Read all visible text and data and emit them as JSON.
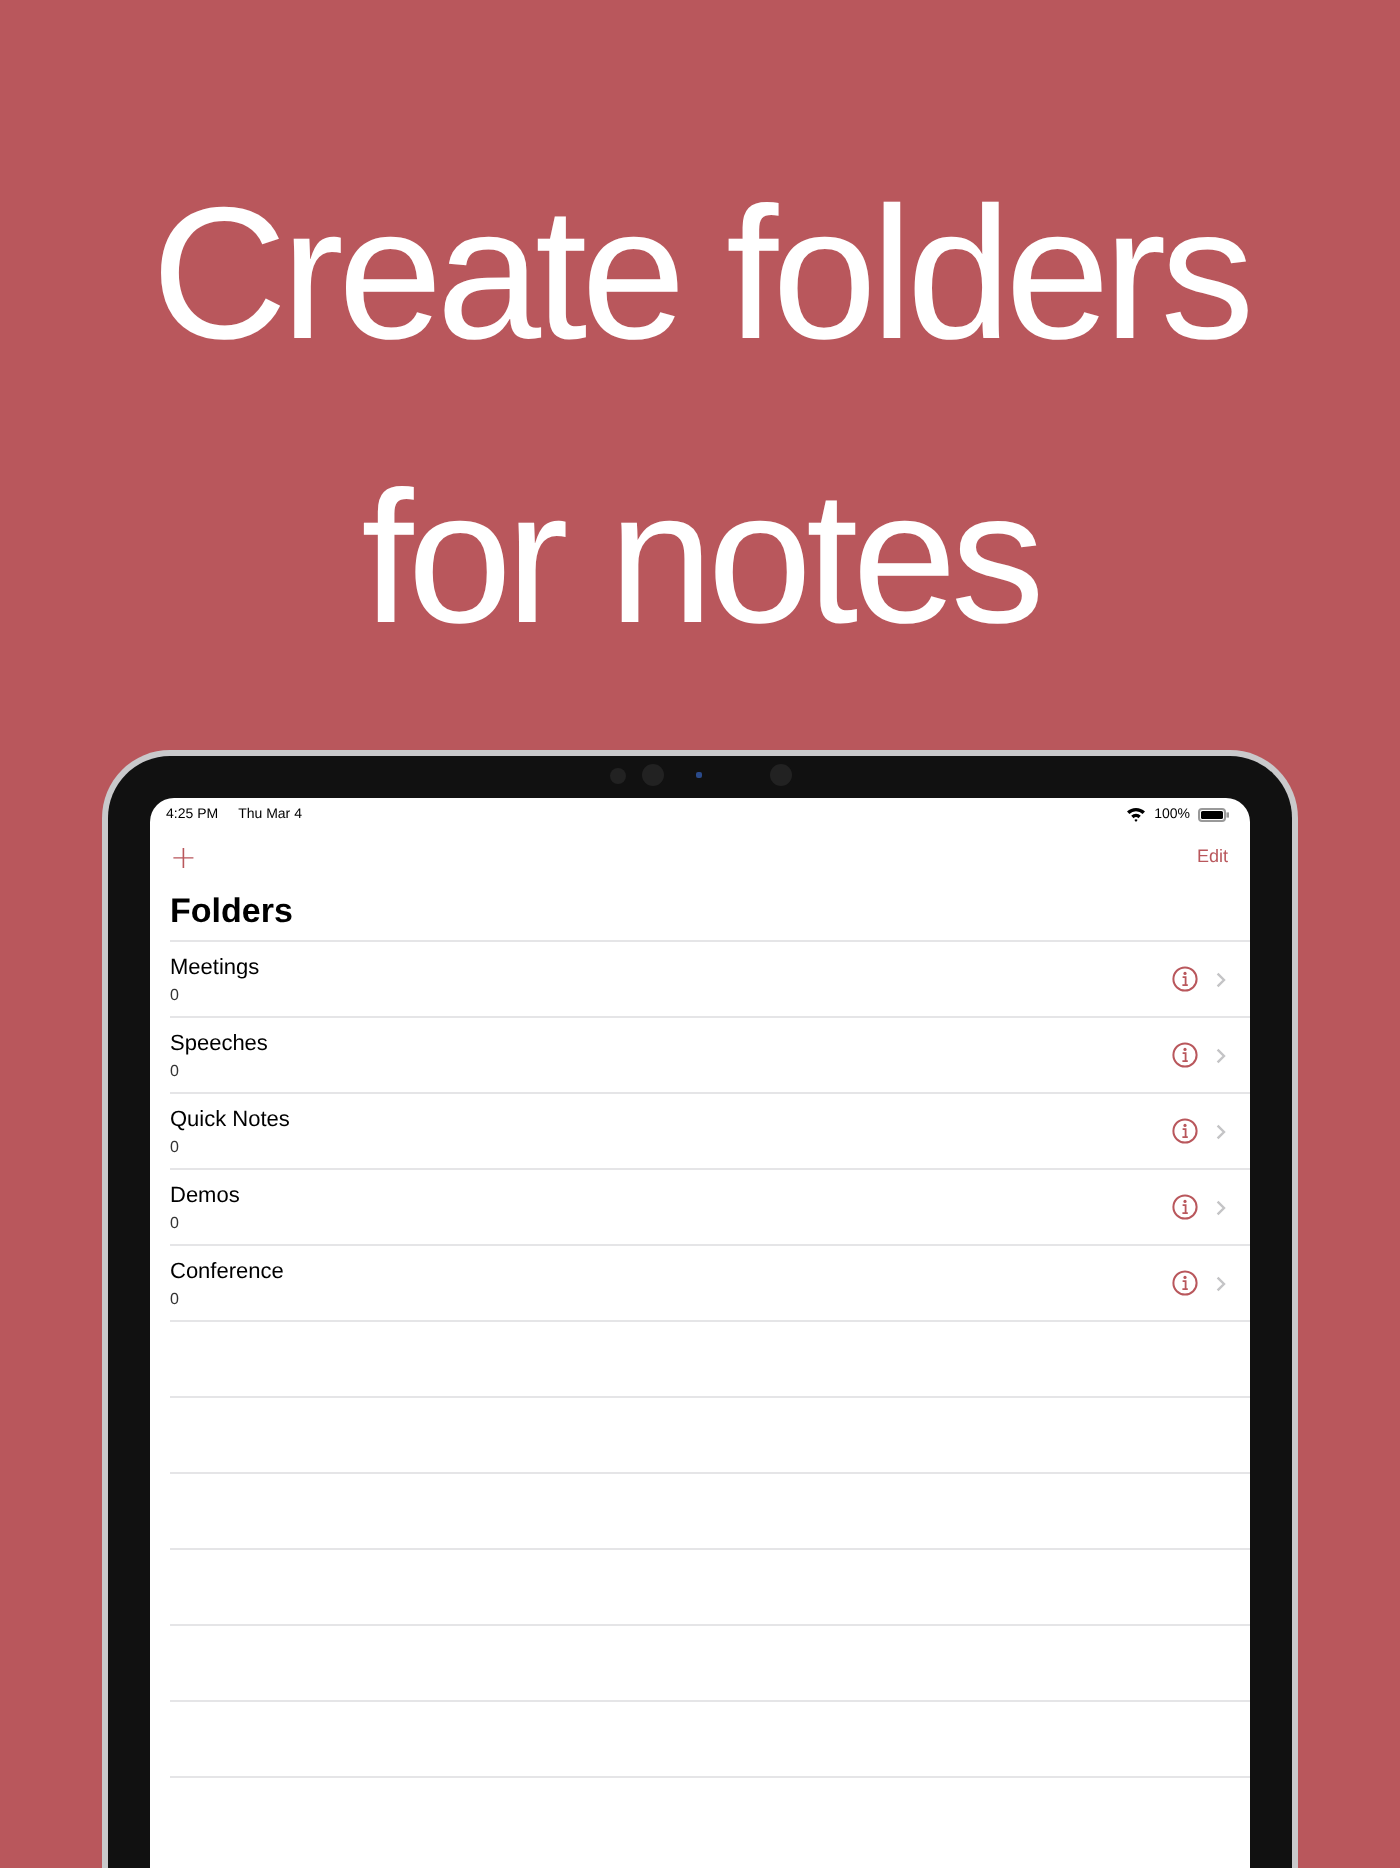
{
  "headline": [
    "Create folders",
    "for notes"
  ],
  "status_bar": {
    "time": "4:25 PM",
    "date": "Thu Mar 4",
    "battery": "100%"
  },
  "nav": {
    "add": "+",
    "edit": "Edit",
    "title": "Folders"
  },
  "folders": [
    {
      "name": "Meetings",
      "count": "0"
    },
    {
      "name": "Speeches",
      "count": "0"
    },
    {
      "name": "Quick Notes",
      "count": "0"
    },
    {
      "name": "Demos",
      "count": "0"
    },
    {
      "name": "Conference",
      "count": "0"
    }
  ]
}
